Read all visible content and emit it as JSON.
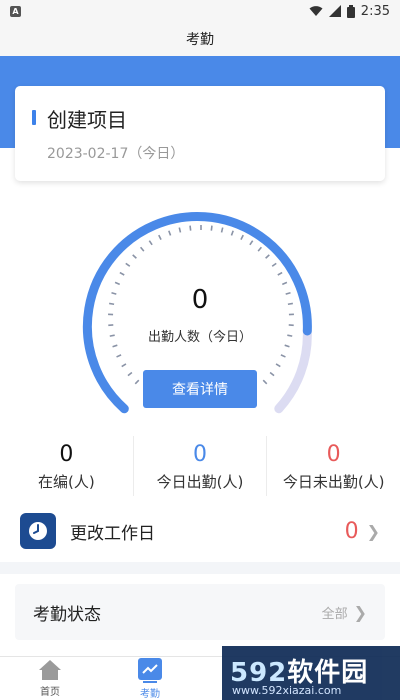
{
  "status_bar": {
    "time": "2:35"
  },
  "header": {
    "title": "考勤"
  },
  "project": {
    "title": "创建项目",
    "date": "2023-02-17（今日）"
  },
  "gauge": {
    "value": "0",
    "label": "出勤人数（今日）",
    "button_label": "查看详情"
  },
  "stats": [
    {
      "value": "0",
      "label": "在编(人)",
      "color": "#111111"
    },
    {
      "value": "0",
      "label": "今日出勤(人)",
      "color": "#4a89e8"
    },
    {
      "value": "0",
      "label": "今日未出勤(人)",
      "color": "#e85a5a"
    }
  ],
  "workday": {
    "label": "更改工作日",
    "count": "0"
  },
  "attendance_status": {
    "title": "考勤状态",
    "filter": "全部"
  },
  "bottom_nav": [
    {
      "label": "首页",
      "icon": "home-icon"
    },
    {
      "label": "考勤",
      "icon": "chart-icon"
    }
  ],
  "watermark": {
    "brand_num": "592",
    "brand_text": "软件园",
    "url": "www.592xiazai.com"
  },
  "colors": {
    "accent": "#4a89e8",
    "danger": "#e85a5a",
    "gauge_track": "#dcdcf2"
  }
}
